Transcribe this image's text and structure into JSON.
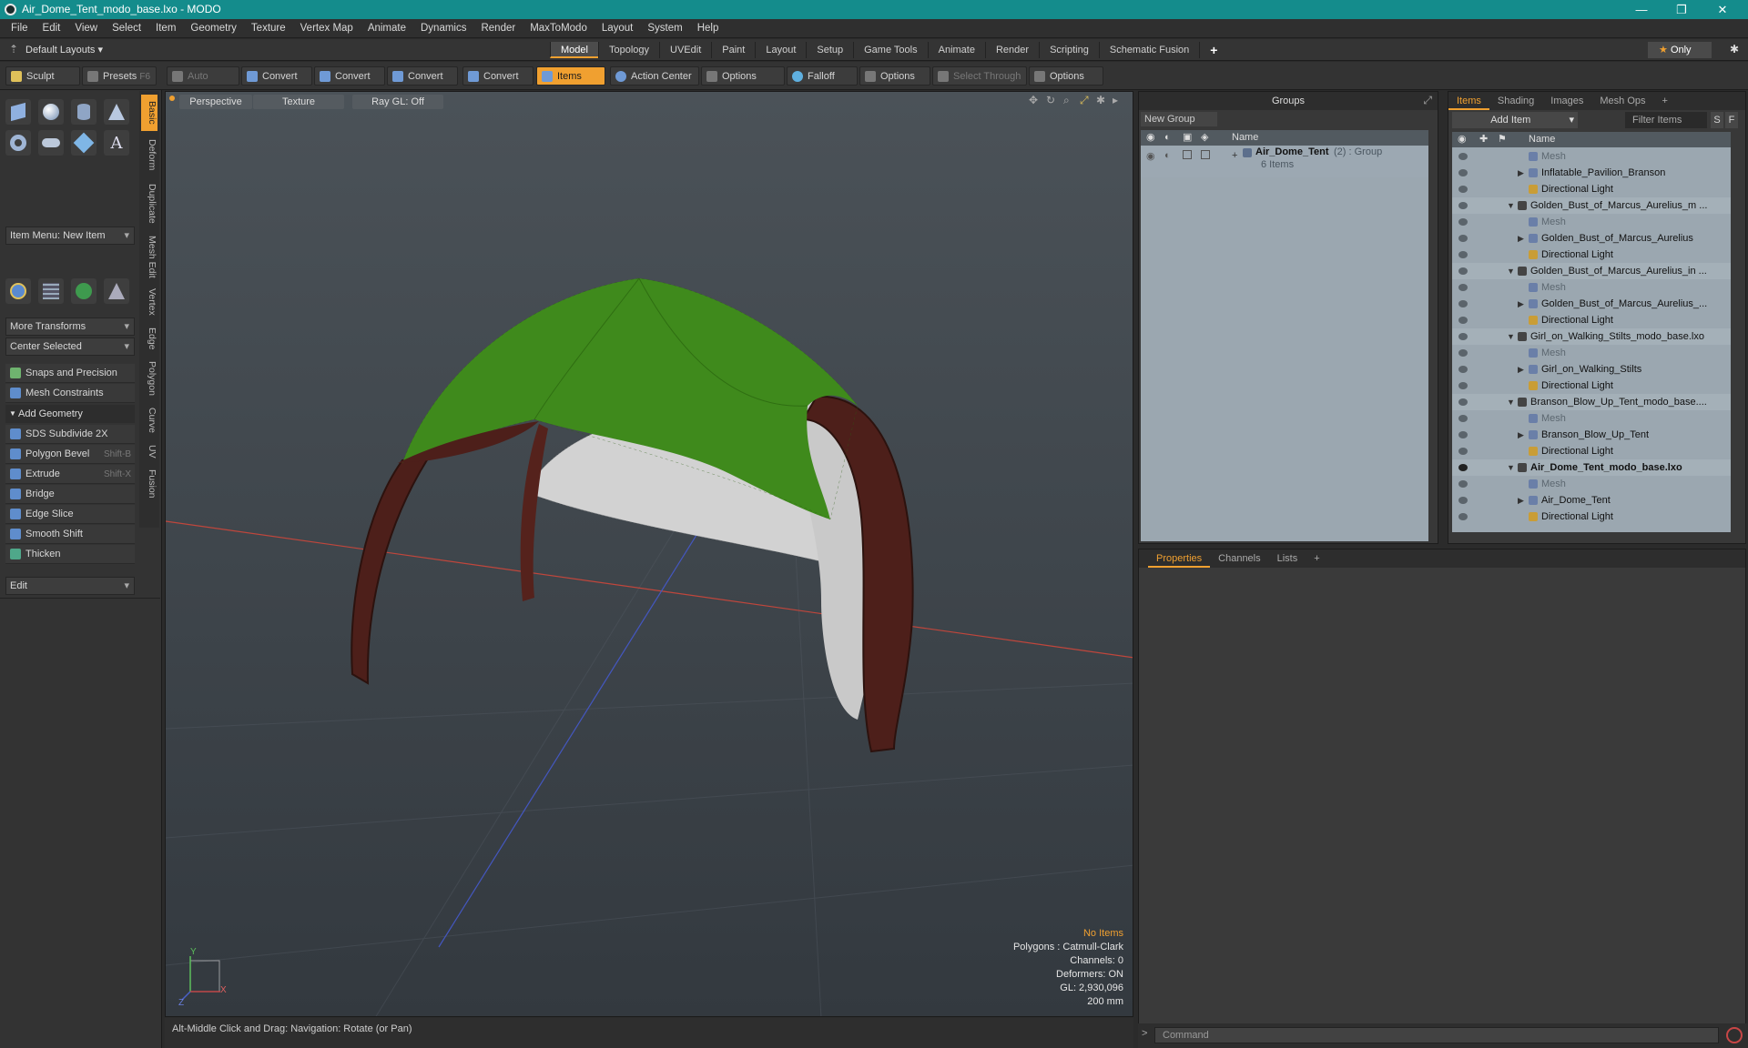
{
  "window": {
    "title": "Air_Dome_Tent_modo_base.lxo - MODO",
    "minimize": "—",
    "restore": "❐",
    "close": "✕"
  },
  "menu": [
    "File",
    "Edit",
    "View",
    "Select",
    "Item",
    "Geometry",
    "Texture",
    "Vertex Map",
    "Animate",
    "Dynamics",
    "Render",
    "MaxToModo",
    "Layout",
    "System",
    "Help"
  ],
  "layouts": {
    "current": "Default Layouts",
    "tabs": [
      "Model",
      "Topology",
      "UVEdit",
      "Paint",
      "Layout",
      "Setup",
      "Game Tools",
      "Animate",
      "Render",
      "Scripting",
      "Schematic Fusion"
    ],
    "active_tab": "Model",
    "add": "+",
    "only": "Only"
  },
  "toolbar": {
    "sculpt": "Sculpt",
    "presets": "Presets",
    "presets_key": "F6",
    "auto_select": "Auto Select",
    "convert1": "Convert",
    "convert2": "Convert",
    "convert3": "Convert",
    "convert4": "Convert",
    "items": "Items",
    "action_center": "Action Center",
    "options1": "Options",
    "falloff": "Falloff",
    "options2": "Options",
    "select_through": "Select Through",
    "options3": "Options"
  },
  "left_panel": {
    "vtabs": [
      "Basic",
      "Deform",
      "Duplicate",
      "Mesh Edit",
      "Vertex",
      "Edge",
      "Polygon",
      "Curve",
      "UV",
      "Fusion"
    ],
    "item_menu": "Item Menu: New Item",
    "more_transforms": "More Transforms",
    "center_selected": "Center Selected",
    "snaps": "Snaps and Precision",
    "mesh_constraints": "Mesh Constraints",
    "add_geometry": "Add Geometry",
    "tools": [
      {
        "label": "SDS Subdivide 2X",
        "key": ""
      },
      {
        "label": "Polygon Bevel",
        "key": "Shift-B"
      },
      {
        "label": "Extrude",
        "key": "Shift-X"
      },
      {
        "label": "Bridge",
        "key": ""
      },
      {
        "label": "Edge Slice",
        "key": ""
      },
      {
        "label": "Smooth Shift",
        "key": ""
      },
      {
        "label": "Thicken",
        "key": ""
      }
    ],
    "edit": "Edit"
  },
  "viewport": {
    "view": "Perspective",
    "shading": "Texture",
    "raygl": "Ray GL: Off",
    "info": {
      "selection": "No Items",
      "polygons": "Polygons : Catmull-Clark",
      "channels": "Channels: 0",
      "deformers": "Deformers: ON",
      "gl": "GL: 2,930,096",
      "scale": "200 mm"
    },
    "axis": {
      "y": "Y",
      "z": "Z",
      "x": "X"
    },
    "colors": {
      "canopy": "#3f8a1c",
      "arch": "#4a1f1a",
      "mesh": "#bfbfbf"
    }
  },
  "status": {
    "hint": "Alt-Middle Click and Drag:   Navigation: Rotate (or Pan)"
  },
  "groups": {
    "title": "Groups",
    "new_group": "New Group",
    "col_name": "Name",
    "row": {
      "name": "Air_Dome_Tent",
      "suffix": "(2) : Group",
      "count": "6 Items"
    }
  },
  "items_panel": {
    "tabs": [
      "Items",
      "Shading",
      "Images",
      "Mesh Ops"
    ],
    "add_item": "Add Item",
    "filter": "Filter Items",
    "btn_s": "S",
    "btn_f": "F",
    "col_name": "Name",
    "rows": [
      {
        "label": "Mesh",
        "kind": "mesh",
        "indent": 2,
        "dim": true
      },
      {
        "label": "Inflatable_Pavilion_Branson",
        "kind": "mesh",
        "indent": 2,
        "arrow": true
      },
      {
        "label": "Directional Light",
        "kind": "light",
        "indent": 2
      },
      {
        "label": "Golden_Bust_of_Marcus_Aurelius_m ...",
        "kind": "scn",
        "indent": 1,
        "open": true
      },
      {
        "label": "Mesh",
        "kind": "mesh",
        "indent": 2,
        "dim": true
      },
      {
        "label": "Golden_Bust_of_Marcus_Aurelius",
        "kind": "mesh",
        "indent": 2,
        "arrow": true
      },
      {
        "label": "Directional Light",
        "kind": "light",
        "indent": 2
      },
      {
        "label": "Golden_Bust_of_Marcus_Aurelius_in ...",
        "kind": "scn",
        "indent": 1,
        "open": true
      },
      {
        "label": "Mesh",
        "kind": "mesh",
        "indent": 2,
        "dim": true
      },
      {
        "label": "Golden_Bust_of_Marcus_Aurelius_...",
        "kind": "mesh",
        "indent": 2,
        "arrow": true
      },
      {
        "label": "Directional Light",
        "kind": "light",
        "indent": 2
      },
      {
        "label": "Girl_on_Walking_Stilts_modo_base.lxo",
        "kind": "scn",
        "indent": 1,
        "open": true
      },
      {
        "label": "Mesh",
        "kind": "mesh",
        "indent": 2,
        "dim": true
      },
      {
        "label": "Girl_on_Walking_Stilts",
        "kind": "mesh",
        "indent": 2,
        "arrow": true
      },
      {
        "label": "Directional Light",
        "kind": "light",
        "indent": 2
      },
      {
        "label": "Branson_Blow_Up_Tent_modo_base....",
        "kind": "scn",
        "indent": 1,
        "open": true
      },
      {
        "label": "Mesh",
        "kind": "mesh",
        "indent": 2,
        "dim": true
      },
      {
        "label": "Branson_Blow_Up_Tent",
        "kind": "mesh",
        "indent": 2,
        "arrow": true
      },
      {
        "label": "Directional Light",
        "kind": "light",
        "indent": 2
      },
      {
        "label": "Air_Dome_Tent_modo_base.lxo",
        "kind": "scn",
        "indent": 1,
        "open": true,
        "bold": true
      },
      {
        "label": "Mesh",
        "kind": "mesh",
        "indent": 2,
        "dim": true
      },
      {
        "label": "Air_Dome_Tent",
        "kind": "mesh",
        "indent": 2,
        "arrow": true
      },
      {
        "label": "Directional Light",
        "kind": "light",
        "indent": 2
      }
    ]
  },
  "properties": {
    "tabs": [
      "Properties",
      "Channels",
      "Lists"
    ],
    "add": "+"
  },
  "command": {
    "placeholder": "Command",
    "prompt": ">"
  }
}
